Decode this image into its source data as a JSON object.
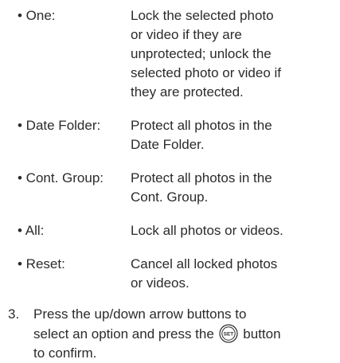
{
  "options": [
    {
      "term": "• One:",
      "desc_lines": [
        "Lock the selected photo",
        "or video if they are",
        "unprotected; unlock the",
        "selected photo or video if",
        "they are protected."
      ]
    },
    {
      "term": "• Date Folder:",
      "desc_lines": [
        "Protect all photos in the",
        "Date Folder."
      ]
    },
    {
      "term": "• Cont. Group:",
      "desc_lines": [
        "Protect all photos in the",
        "Cont. Group."
      ]
    },
    {
      "term": "• All:",
      "desc_lines": [
        "Lock all photos or videos."
      ]
    },
    {
      "term": "• Reset:",
      "desc_lines": [
        "Cancel all locked photos",
        "or videos."
      ]
    }
  ],
  "step": {
    "number": "3.",
    "line1": "Press the up/down arrow buttons to",
    "line2_before": "select an option and press the",
    "icon_name": "set-button-icon",
    "icon_label": "SET",
    "line2_after": "button",
    "line3": "to confirm."
  }
}
